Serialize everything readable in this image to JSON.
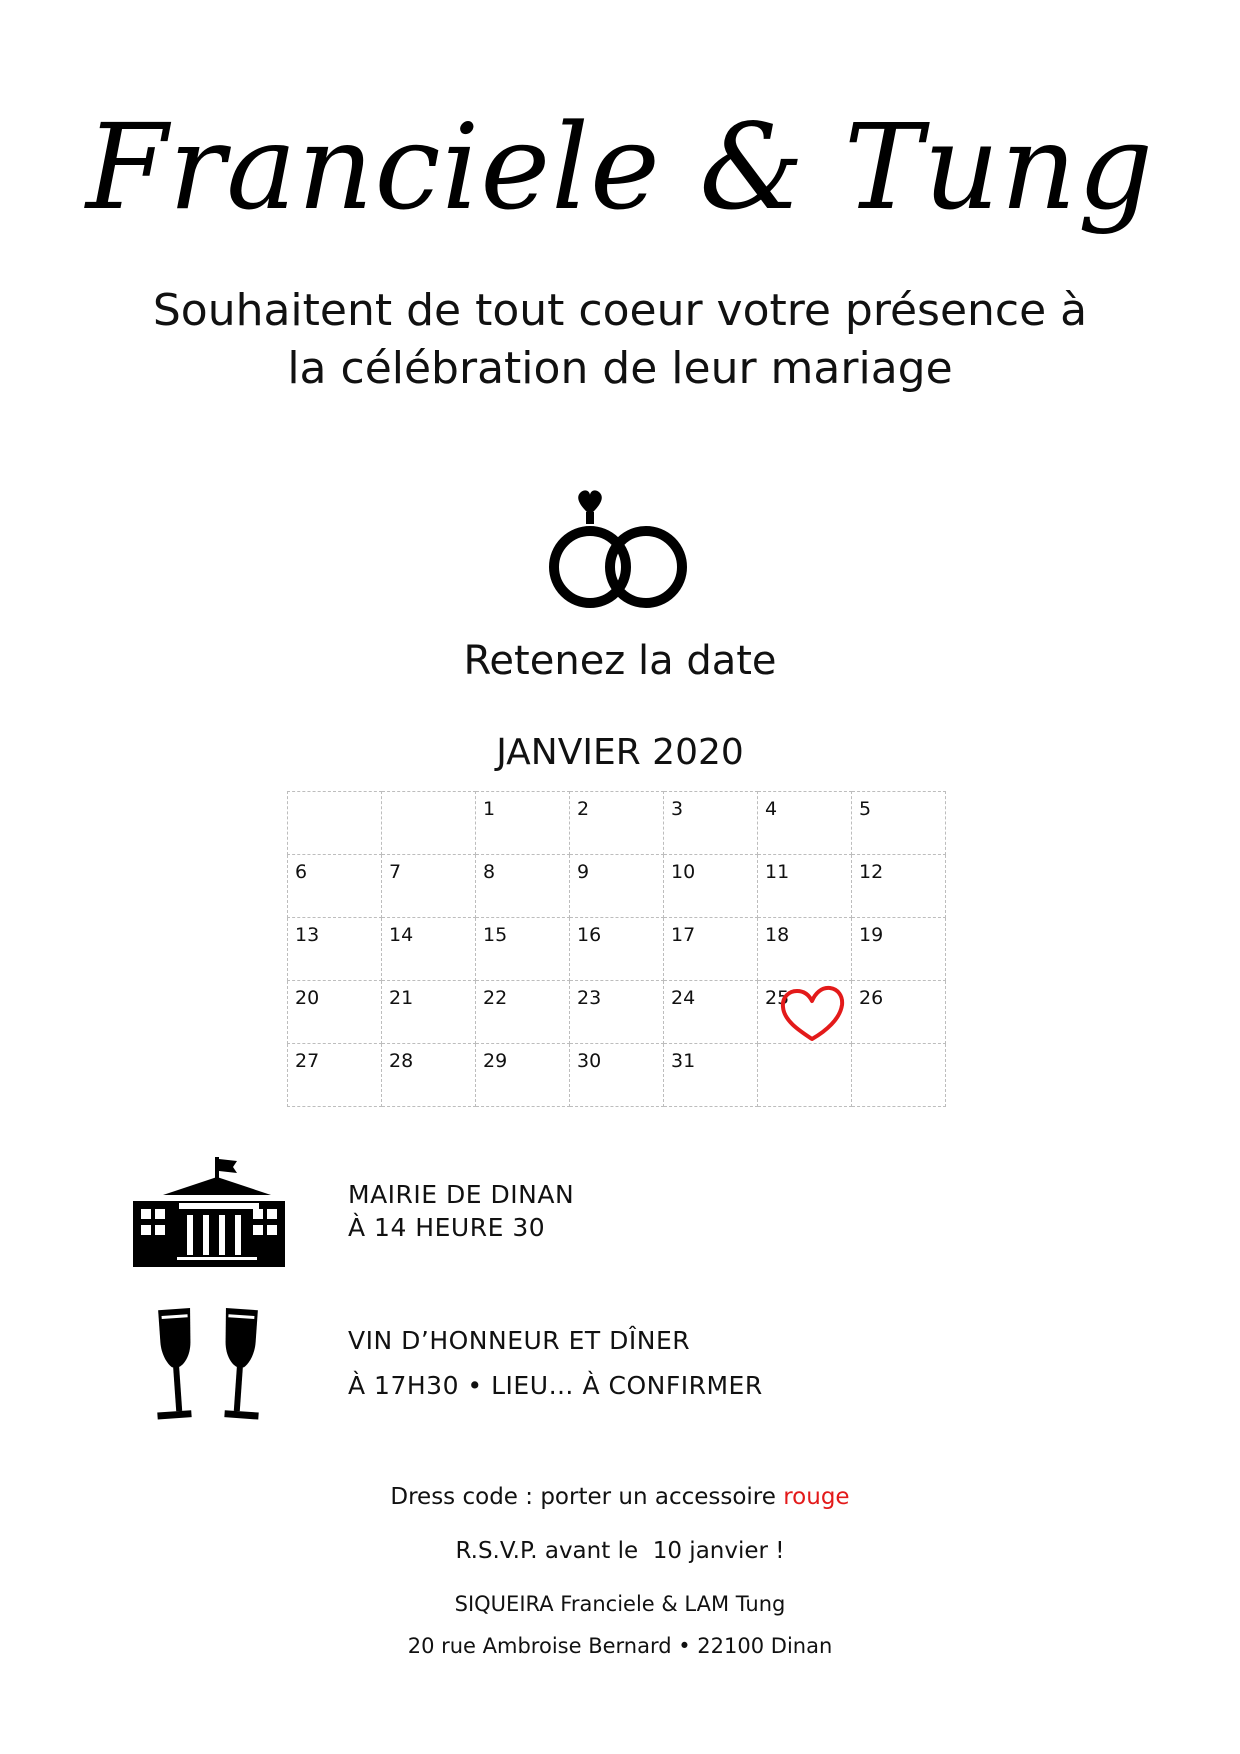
{
  "header": {
    "names": "Franciele & Tung",
    "invitation": "Souhaitent de tout coeur votre présence à la célébration de leur mariage"
  },
  "save_the_date": "Retenez la date",
  "calendar": {
    "month": "JANVIER 2020",
    "weeks": [
      [
        "",
        "",
        "1",
        "2",
        "3",
        "4",
        "5"
      ],
      [
        "6",
        "7",
        "8",
        "9",
        "10",
        "11",
        "12"
      ],
      [
        "13",
        "14",
        "15",
        "16",
        "17",
        "18",
        "19"
      ],
      [
        "20",
        "21",
        "22",
        "23",
        "24",
        "25",
        "26"
      ],
      [
        "27",
        "28",
        "29",
        "30",
        "31",
        "",
        ""
      ]
    ],
    "highlighted_day": "25",
    "highlight_color": "#e31a1a"
  },
  "events": [
    {
      "icon": "town-hall-icon",
      "line1": "MAIRIE DE DINAN",
      "line2": "À 14 HEURE 30"
    },
    {
      "icon": "champagne-glasses-icon",
      "line1": "VIN D’HONNEUR ET DÎNER",
      "line2": "À 17H30 • LIEU… À CONFIRMER"
    }
  ],
  "footer": {
    "dress_code_prefix": "Dress code : porter un accessoire",
    "dress_code_color_word": "rouge",
    "rsvp": "R.S.V.P. avant le  10 janvier !",
    "names": "SIQUEIRA Franciele & LAM Tung",
    "address": "20 rue Ambroise Bernard • 22100 Dinan"
  }
}
